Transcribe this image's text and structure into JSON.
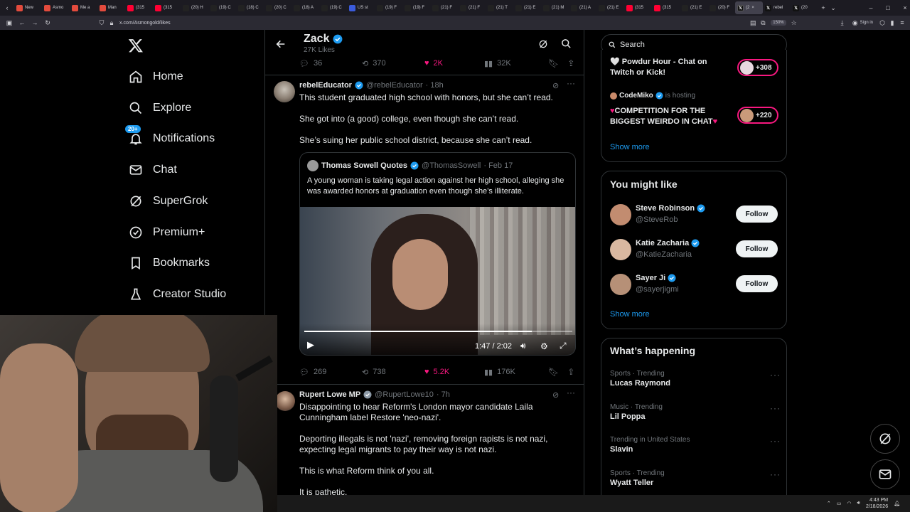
{
  "browser": {
    "tabs": [
      {
        "title": "New",
        "icon_color": "#e34b3d"
      },
      {
        "title": "Asmo",
        "icon_color": "#e34b3d"
      },
      {
        "title": "Me a",
        "icon_color": "#e34b3d"
      },
      {
        "title": "Man",
        "icon_color": "#e34b3d"
      },
      {
        "title": "(315",
        "icon_color": "#ff0033"
      },
      {
        "title": "(315",
        "icon_color": "#ff0033"
      },
      {
        "title": "(20) H",
        "icon_color": "#222"
      },
      {
        "title": "(19) C",
        "icon_color": "#222"
      },
      {
        "title": "(18) C",
        "icon_color": "#222"
      },
      {
        "title": "(20) C",
        "icon_color": "#222"
      },
      {
        "title": "(18) A",
        "icon_color": "#222"
      },
      {
        "title": "(19) C",
        "icon_color": "#222"
      },
      {
        "title": "US st",
        "icon_color": "#3b5bdb"
      },
      {
        "title": "(19) F",
        "icon_color": "#222"
      },
      {
        "title": "(19) F",
        "icon_color": "#222"
      },
      {
        "title": "(21) F",
        "icon_color": "#222"
      },
      {
        "title": "(21) F",
        "icon_color": "#222"
      },
      {
        "title": "(21) T",
        "icon_color": "#222"
      },
      {
        "title": "(21) E",
        "icon_color": "#222"
      },
      {
        "title": "(21) M",
        "icon_color": "#222"
      },
      {
        "title": "(21) A",
        "icon_color": "#222"
      },
      {
        "title": "(21) E",
        "icon_color": "#222"
      },
      {
        "title": "(315",
        "icon_color": "#ff0033"
      },
      {
        "title": "(315",
        "icon_color": "#ff0033"
      },
      {
        "title": "(21) E",
        "icon_color": "#222"
      },
      {
        "title": "(20) F",
        "icon_color": "#222"
      }
    ],
    "active_tab": {
      "title": "(2"
    },
    "after_tabs": [
      {
        "title": "rebel"
      },
      {
        "title": "(20"
      }
    ],
    "url": "x.com/Asmongold/likes",
    "zoom": "150%",
    "sign_in": "Sign in"
  },
  "nav": {
    "items": [
      {
        "label": "Home"
      },
      {
        "label": "Explore"
      },
      {
        "label": "Notifications",
        "badge": "20+"
      },
      {
        "label": "Chat"
      },
      {
        "label": "SuperGrok"
      },
      {
        "label": "Premium+"
      },
      {
        "label": "Bookmarks"
      },
      {
        "label": "Creator Studio"
      }
    ]
  },
  "header": {
    "name": "Zack",
    "subtitle": "27K Likes"
  },
  "prev_tweet_actions": {
    "replies": "36",
    "reposts": "370",
    "likes": "2K",
    "views": "32K"
  },
  "tweet1": {
    "name": "rebelEducator",
    "handle": "@rebelEducator",
    "time": "· 18h",
    "paragraphs": [
      "This student graduated high school with honors, but she can’t read.",
      "She got into (a good) college, even though she can’t read.",
      "She’s suing her public school district, because she can’t read."
    ],
    "quote": {
      "name": "Thomas Sowell Quotes",
      "handle": "@ThomasSowell",
      "time": "· Feb 17",
      "text": "A young woman is taking legal action against her high school, alleging she was awarded honors at graduation even though she’s illiterate."
    },
    "video": {
      "time": "1:47 / 2:02",
      "progress": 0.85
    },
    "actions": {
      "replies": "269",
      "reposts": "738",
      "likes": "5.2K",
      "views": "176K"
    }
  },
  "tweet2": {
    "name": "Rupert Lowe MP",
    "handle": "@RupertLowe10",
    "time": "· 7h",
    "paragraphs": [
      "Disappointing to hear Reform's London mayor candidate Laila Cunningham label Restore 'neo-nazi'.",
      "Deporting illegals is not 'nazi', removing foreign rapists is not nazi, expecting legal migrants to pay their way is not nazi.",
      "This is what Reform think of you all.",
      "It is pathetic."
    ]
  },
  "search": {
    "placeholder": "Search"
  },
  "live": {
    "item1": {
      "text": "Powdur Hour - Chat on Twitch or  Kick!",
      "count": "+308"
    },
    "item2": {
      "streamer": "CodeMiko",
      "status": "is hosting",
      "text": "COMPETITION FOR THE BIGGEST WEIRDO IN CHAT",
      "count": "+220"
    },
    "show_more": "Show more"
  },
  "who_to_follow": {
    "title": "You might like",
    "people": [
      {
        "name": "Steve Robinson",
        "handle": "@SteveRob",
        "button": "Follow"
      },
      {
        "name": "Katie Zacharia",
        "handle": "@KatieZacharia",
        "button": "Follow"
      },
      {
        "name": "Sayer Ji",
        "handle": "@sayerjigmi",
        "button": "Follow"
      }
    ],
    "show_more": "Show more"
  },
  "trends": {
    "title": "What’s happening",
    "items": [
      {
        "category": "Sports · Trending",
        "name": "Lucas Raymond"
      },
      {
        "category": "Music · Trending",
        "name": "Lil Poppa"
      },
      {
        "category": "Trending in United States",
        "name": "Slavin"
      },
      {
        "category": "Sports · Trending",
        "name": "Wyatt Teller"
      }
    ]
  },
  "taskbar": {
    "time": "4:43 PM",
    "date": "2/18/2026"
  },
  "colors": {
    "accent": "#1d9bf0",
    "like": "#f91880",
    "bg": "#000000",
    "border": "#2f3336"
  }
}
